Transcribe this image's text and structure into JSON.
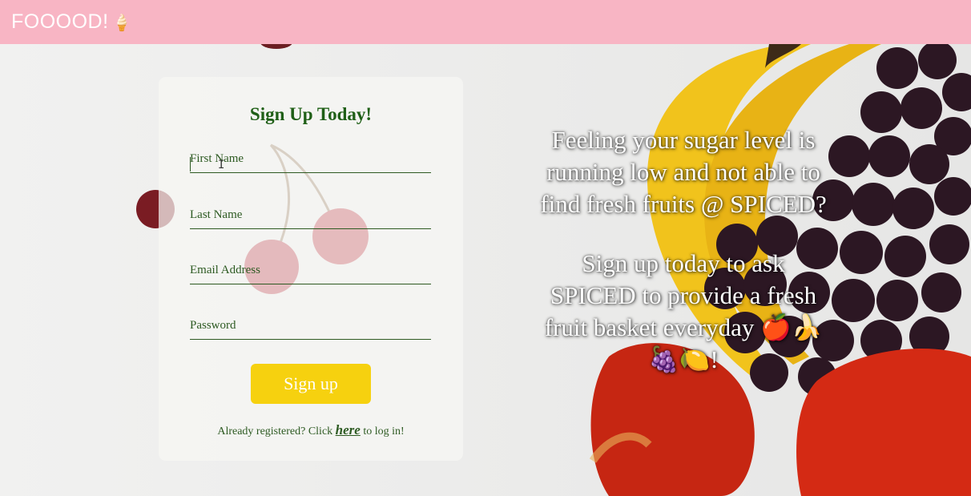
{
  "header": {
    "brand": "FOOOOD!",
    "brand_icon": "🍦"
  },
  "form": {
    "title": "Sign Up Today!",
    "fields": [
      {
        "placeholder": "First Name",
        "value": ""
      },
      {
        "placeholder": "Last Name",
        "value": ""
      },
      {
        "placeholder": "Email Address",
        "value": ""
      },
      {
        "placeholder": "Password",
        "value": ""
      }
    ],
    "submit_label": "Sign up",
    "login_prefix": "Already registered? Click ",
    "login_link": "here",
    "login_suffix": " to log in!"
  },
  "promo": {
    "line1": "Feeling your sugar level is running low and not able to find fresh fruits @ SPICED?",
    "line2": "Sign up today to ask SPICED to provide a fresh fruit basket everyday 🍎🍌🍇🍋!"
  },
  "colors": {
    "header_bg": "#f8b5c4",
    "accent_green": "#1f5f17",
    "button_bg": "#f6d10f"
  }
}
